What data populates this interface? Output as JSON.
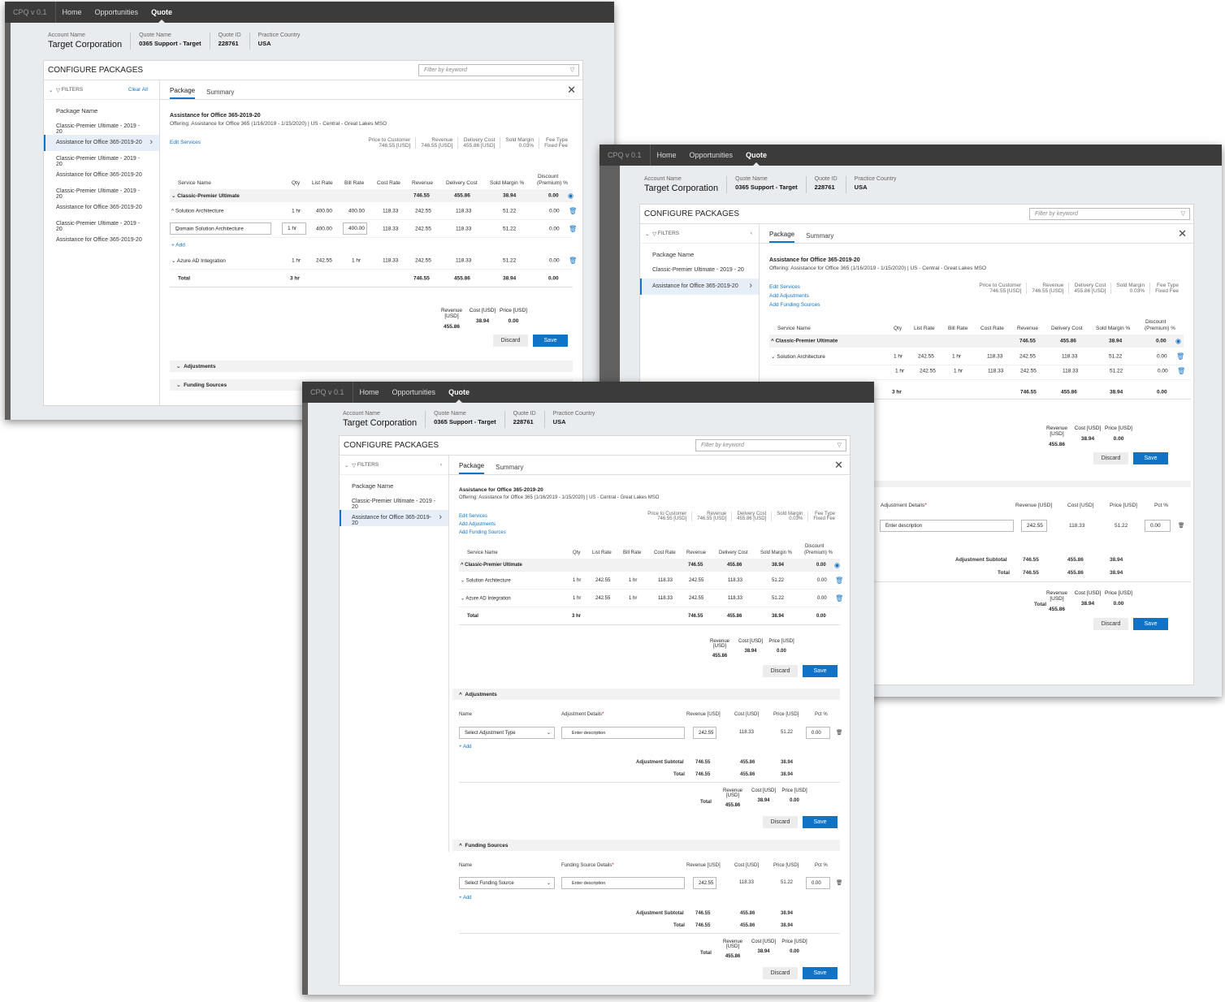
{
  "nav": {
    "version": "CPQ v 0.1",
    "items": [
      "Home",
      "Opportunities",
      "Quote"
    ]
  },
  "header": {
    "account_label": "Account Name",
    "account": "Target Corporation",
    "quote_label": "Quote Name",
    "quote": "0365 Support - Target",
    "id_label": "Quote ID",
    "id": "228761",
    "country_label": "Practice Country",
    "country": "USA"
  },
  "title": "CONFIGURE PACKAGES",
  "filter_placeholder": "Filter by keyword",
  "filters": {
    "label": "FILTERS",
    "clear": "Clear All",
    "package_name": "Package Name"
  },
  "packages_a": [
    "Classic-Premier Ultimate - 2019 - 20",
    "Assistance for Office 365-2019-20",
    "Classic-Premier Ultimate - 2019 - 20",
    "Assistance for Office 365-2019-20",
    "Classic-Premier Ultimate - 2019 - 20",
    "Assistance for Office 365-2019-20",
    "Classic-Premier Ultimate - 2019 - 20",
    "Assistance for Office 365-2019-20"
  ],
  "packages_b": [
    "Classic-Premier Ultimate - 2019 - 20",
    "Assistance for Office 365-2019-20"
  ],
  "tabs": [
    "Package",
    "Summary"
  ],
  "package": {
    "title": "Assistance for Office 365-2019-20",
    "offering_a": "Offering: Assistance for Office 365 (1/16/2019 - 1/15/2020)  |  US - Central - Great Lakes MSO",
    "offering_b": "Offering: Assistance for Office 365 (1/16/2019 - 1/15/2020)  |  US - Central - Great Lakes MSO"
  },
  "links": {
    "edit": "Edit Services",
    "adj": "Add Adjustments",
    "fund": "Add Funding Sources",
    "add": "+ Add"
  },
  "metrics": {
    "ptc_l": "Price to Customer",
    "ptc": "746.55 [USD]",
    "rev_l": "Revenue",
    "rev": "746.55 [USD]",
    "dc_l": "Delivery Cost",
    "dc": "455.86 [USD]",
    "sm_l": "Sold Margin",
    "sm": "0.03%",
    "ft_l": "Fee Type",
    "ft": "Fixed Fee"
  },
  "cols": {
    "svc": "Service Name",
    "qty": "Qty",
    "list": "List Rate",
    "bill": "Bill Rate",
    "cost": "Cost Rate",
    "rev": "Revenue",
    "dc": "Delivery Cost",
    "sm": "Sold Margin %",
    "disc1": "Discount",
    "disc2": "(Premium) %"
  },
  "rows": {
    "grp": {
      "name": "Classic-Premier Ultimate",
      "rev": "746.55",
      "dc": "455.86",
      "sm": "38.94",
      "disc": "0.00"
    },
    "sa": {
      "name": "Solution Architecture",
      "qty": "1 hr",
      "list": "400.00",
      "bill": "400.00",
      "cost": "118.33",
      "rev": "242.55",
      "dc": "118.33",
      "sm": "51.22",
      "disc": "0.00"
    },
    "dsa": {
      "name": "Domain Solution Architecture",
      "qty": "1 hr",
      "list": "400.00",
      "bill": "400.00",
      "cost": "118.33",
      "rev": "242.55",
      "dc": "118.33",
      "sm": "51.22",
      "disc": "0.00"
    },
    "az": {
      "name": "Azure AD Integration",
      "qty": "1 hr",
      "list": "242.55",
      "bill": "1 hr",
      "cost": "118.33",
      "rev": "242.55",
      "dc": "118.33",
      "sm": "51.22",
      "disc": "0.00"
    },
    "total": {
      "name": "Total",
      "qty": "3 hr",
      "rev": "746.55",
      "dc": "455.86",
      "sm": "38.94",
      "disc": "0.00"
    }
  },
  "summary": {
    "rev_l": "Revenue [USD]",
    "cost_l": "Cost [USD]",
    "price_l": "Price [USD]",
    "rev": "455.86",
    "cost": "38.94",
    "price": "0.00",
    "total": "Total"
  },
  "buttons": {
    "discard": "Discard",
    "save": "Save"
  },
  "sections": {
    "adj": "Adjustments",
    "fund": "Funding Sources"
  },
  "adj": {
    "name_l": "Name",
    "details_l": "Adjustment Details",
    "fund_details_l": "Funding Source Details",
    "rev_l": "Revenue [USD]",
    "cost_l": "Cost [USD]",
    "price_l": "Price [USD]",
    "pct_l": "Pct %",
    "type_ph": "Select Adjustment Type",
    "fund_ph": "Select Funding Source",
    "desc_ph": "Enter description",
    "rev": "242.55",
    "cost": "118.33",
    "price": "51.22",
    "pct": "0.00",
    "subtotal_l": "Adjustment Subtotal",
    "total_l": "Total",
    "sub_rev": "746.55",
    "sub_cost": "455.86",
    "sub_price": "38.94"
  }
}
